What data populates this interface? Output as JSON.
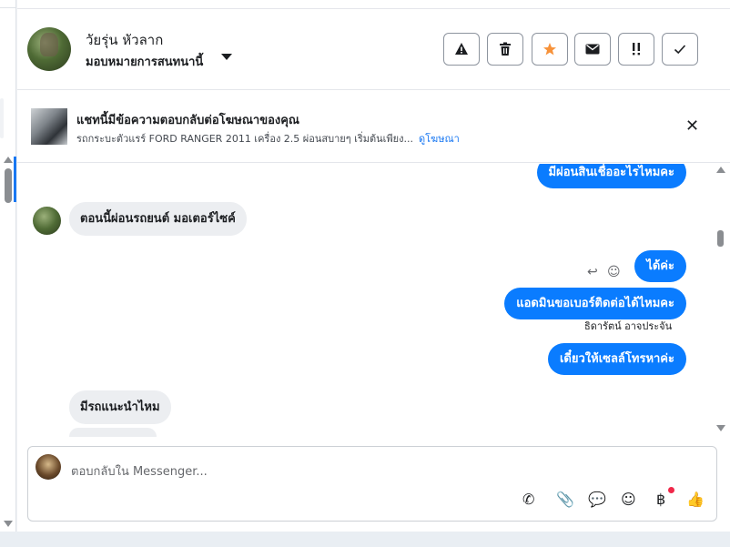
{
  "header": {
    "contact_name": "วัยรุ่น หัวลาก",
    "assign_label": "มอบหมายการสนทนานี้",
    "buttons": [
      {
        "name": "spam-button",
        "glyph": "⚠"
      },
      {
        "name": "delete-button",
        "glyph": "🗑"
      },
      {
        "name": "star-button",
        "glyph": "★"
      },
      {
        "name": "mark-unread-button",
        "glyph": "✉"
      },
      {
        "name": "follow-up-button",
        "glyph": "!!"
      },
      {
        "name": "done-button",
        "glyph": "✓"
      }
    ]
  },
  "ad": {
    "title": "แชทนี้มีข้อความตอบกลับต่อโฆษณาของคุณ",
    "subtitle": "รถกระบะตัวแรร์ FORD RANGER 2011 เครื่อง 2.5 ผ่อนสบายๆ เริ่มต้นเพียง...",
    "view_ad": "ดูโฆษณา",
    "close_glyph": "✕"
  },
  "messages": [
    {
      "direction": "out",
      "text": "มีผ่อนสินเชื่ออะไรไหมคะ"
    },
    {
      "direction": "in",
      "text": "ตอนนี้ผ่อนรถยนต์ มอเตอร์ไซค์"
    },
    {
      "direction": "out",
      "text": "ได้ค่ะ"
    },
    {
      "direction": "out",
      "text": "แอดมินขอเบอร์ติดต่อได้ไหมคะ"
    },
    {
      "direction": "out",
      "text": "เดี๋ยวให้เซลล์โทรหาค่ะ"
    },
    {
      "direction": "in",
      "text": "มีรถแนะนำไหม"
    }
  ],
  "sender_label": "ธิดารัตน์ อาจประจัน",
  "message_actions": {
    "reply_glyph": "↩",
    "react_glyph": "☺"
  },
  "composer": {
    "placeholder": "ตอบกลับใน Messenger...",
    "icons": {
      "call": "✆",
      "attach": "📎",
      "saved_reply": "💬",
      "emoji": "☺",
      "payment": "฿",
      "like": "👍"
    }
  },
  "colors": {
    "outgoing_bubble": "#0a7cff",
    "incoming_bubble": "#eceef1",
    "link": "#1877f2",
    "star": "#f7923a",
    "notification_dot": "#f02849"
  }
}
